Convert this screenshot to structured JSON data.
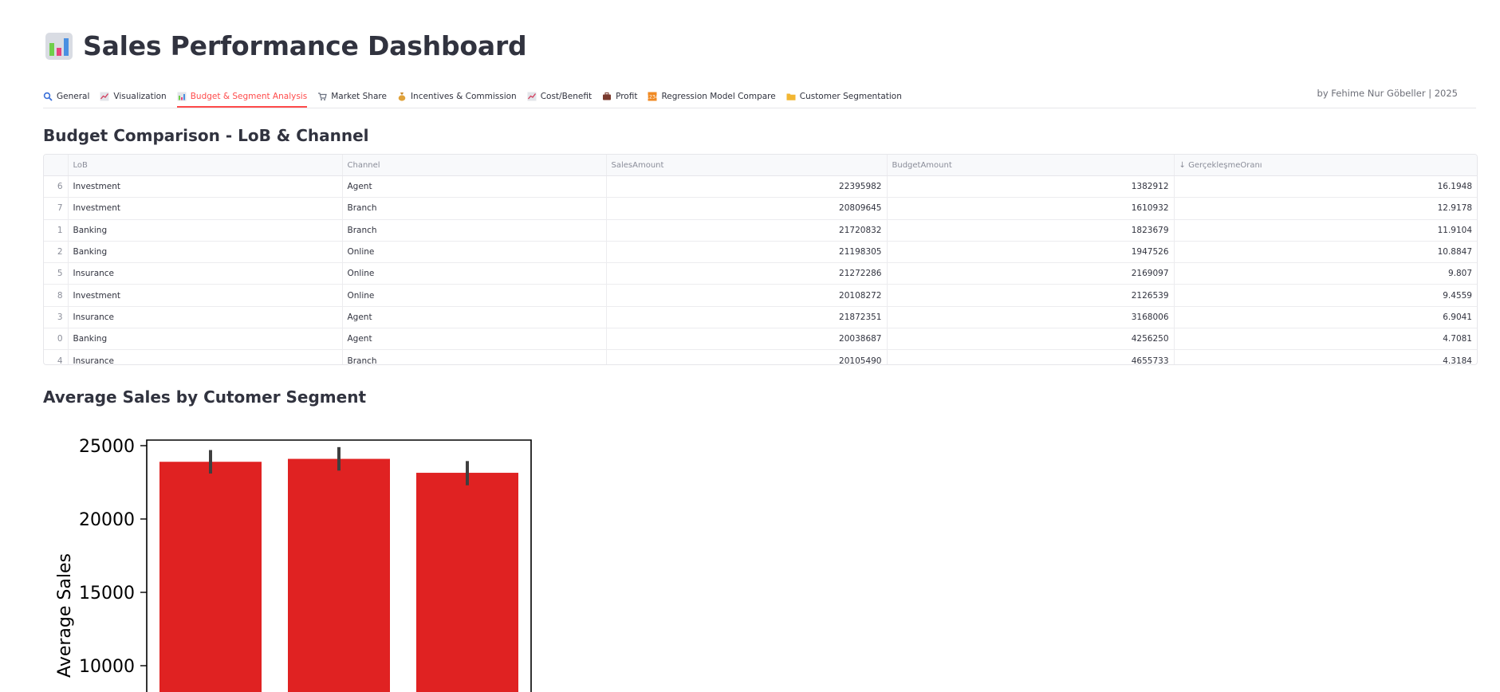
{
  "header": {
    "title": "Sales Performance Dashboard",
    "title_icon": "bar-chart-icon",
    "credit": "by Fehime Nur Göbeller | 2025"
  },
  "tabs": [
    {
      "label": "General",
      "icon": "magnifier-icon",
      "active": false
    },
    {
      "label": "Visualization",
      "icon": "line-chart-icon",
      "active": false
    },
    {
      "label": "Budget & Segment Analysis",
      "icon": "bar-chart-icon",
      "active": true
    },
    {
      "label": "Market Share",
      "icon": "shopping-cart-icon",
      "active": false
    },
    {
      "label": "Incentives & Commission",
      "icon": "money-bag-icon",
      "active": false
    },
    {
      "label": "Cost/Benefit",
      "icon": "line-chart-icon",
      "active": false
    },
    {
      "label": "Profit",
      "icon": "briefcase-icon",
      "active": false
    },
    {
      "label": "Regression Model Compare",
      "icon": "numbers-icon",
      "active": false
    },
    {
      "label": "Customer Segmentation",
      "icon": "folder-icon",
      "active": false
    }
  ],
  "budget_section": {
    "heading": "Budget Comparison - LoB & Channel",
    "columns": [
      "",
      "LoB",
      "Channel",
      "SalesAmount",
      "BudgetAmount",
      "GerçekleşmeOranı"
    ],
    "sort_indicator": "↓",
    "rows": [
      {
        "idx": "6",
        "lob": "Investment",
        "channel": "Agent",
        "sales": "22395982",
        "budget": "1382912",
        "ratio": "16.1948"
      },
      {
        "idx": "7",
        "lob": "Investment",
        "channel": "Branch",
        "sales": "20809645",
        "budget": "1610932",
        "ratio": "12.9178"
      },
      {
        "idx": "1",
        "lob": "Banking",
        "channel": "Branch",
        "sales": "21720832",
        "budget": "1823679",
        "ratio": "11.9104"
      },
      {
        "idx": "2",
        "lob": "Banking",
        "channel": "Online",
        "sales": "21198305",
        "budget": "1947526",
        "ratio": "10.8847"
      },
      {
        "idx": "5",
        "lob": "Insurance",
        "channel": "Online",
        "sales": "21272286",
        "budget": "2169097",
        "ratio": "9.807"
      },
      {
        "idx": "8",
        "lob": "Investment",
        "channel": "Online",
        "sales": "20108272",
        "budget": "2126539",
        "ratio": "9.4559"
      },
      {
        "idx": "3",
        "lob": "Insurance",
        "channel": "Agent",
        "sales": "21872351",
        "budget": "3168006",
        "ratio": "6.9041"
      },
      {
        "idx": "0",
        "lob": "Banking",
        "channel": "Agent",
        "sales": "20038687",
        "budget": "4256250",
        "ratio": "4.7081"
      },
      {
        "idx": "4",
        "lob": "Insurance",
        "channel": "Branch",
        "sales": "20105490",
        "budget": "4655733",
        "ratio": "4.3184"
      }
    ]
  },
  "segment_section": {
    "heading": "Average Sales by Cutomer Segment"
  },
  "colors": {
    "accent": "#ff4b4b",
    "bar": "#e02222",
    "error_bar": "#3f3f3f"
  },
  "chart_data": {
    "type": "bar",
    "ylabel": "Average Sales",
    "yticks": [
      10000,
      15000,
      20000,
      25000
    ],
    "ylim_visible": [
      7500,
      26000
    ],
    "categories": [
      "",
      "",
      ""
    ],
    "values": [
      23900,
      24100,
      23150
    ],
    "error_low": [
      23100,
      23300,
      22300
    ],
    "error_high": [
      24700,
      24900,
      23950
    ]
  }
}
